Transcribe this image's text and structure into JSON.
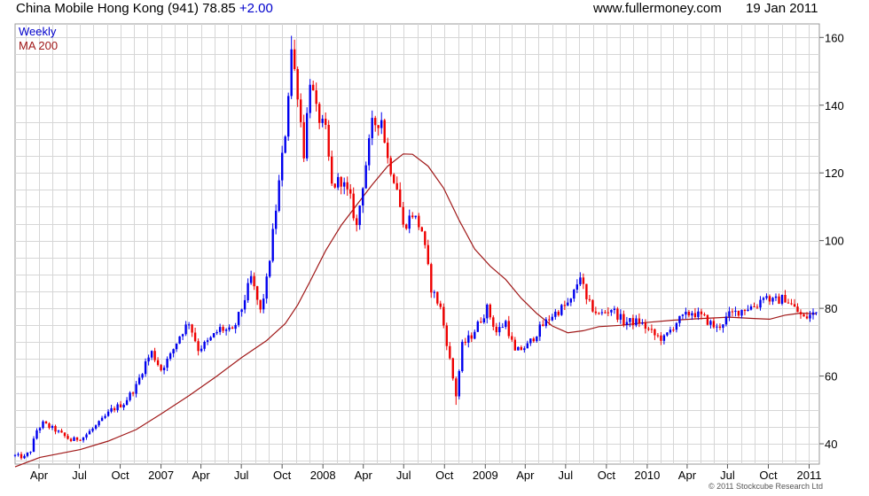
{
  "header": {
    "title": "China Mobile Hong Kong (941) 78.85",
    "change": "+2.00",
    "website": "www.fullermoney.com",
    "date": "19 Jan 2011"
  },
  "legend": {
    "series1": "Weekly",
    "series2": "MA 200"
  },
  "copyright": "© 2011 Stockcube Research Ltd",
  "colors": {
    "up": "#0000ee",
    "down": "#ee0000",
    "ma": "#a01818",
    "grid": "#d6d6d6",
    "change": "#0000cc"
  },
  "chart_data": {
    "type": "candlestick",
    "frequency": "weekly",
    "ylim": [
      34,
      164
    ],
    "yticks": [
      40,
      60,
      80,
      100,
      120,
      140,
      160
    ],
    "x_range": [
      "2006-02-06",
      "2011-01-24"
    ],
    "xticks": [
      {
        "label": "Apr",
        "date": "2006-04-01"
      },
      {
        "label": "Jul",
        "date": "2006-07-01"
      },
      {
        "label": "Oct",
        "date": "2006-10-01"
      },
      {
        "label": "2007",
        "date": "2007-01-01"
      },
      {
        "label": "Apr",
        "date": "2007-04-01"
      },
      {
        "label": "Jul",
        "date": "2007-07-01"
      },
      {
        "label": "Oct",
        "date": "2007-10-01"
      },
      {
        "label": "2008",
        "date": "2008-01-01"
      },
      {
        "label": "Apr",
        "date": "2008-04-01"
      },
      {
        "label": "Jul",
        "date": "2008-07-01"
      },
      {
        "label": "Oct",
        "date": "2008-10-01"
      },
      {
        "label": "2009",
        "date": "2009-01-01"
      },
      {
        "label": "Apr",
        "date": "2009-04-01"
      },
      {
        "label": "Jul",
        "date": "2009-07-01"
      },
      {
        "label": "Oct",
        "date": "2009-10-01"
      },
      {
        "label": "2010",
        "date": "2010-01-01"
      },
      {
        "label": "Apr",
        "date": "2010-04-01"
      },
      {
        "label": "Jul",
        "date": "2010-07-01"
      },
      {
        "label": "Oct",
        "date": "2010-10-01"
      },
      {
        "label": "2011",
        "date": "2011-01-01"
      }
    ],
    "close_anchors": [
      [
        "2006-02-06",
        36.5
      ],
      [
        "2006-02-27",
        36
      ],
      [
        "2006-03-13",
        38
      ],
      [
        "2006-03-27",
        44
      ],
      [
        "2006-04-10",
        46
      ],
      [
        "2006-05-08",
        44
      ],
      [
        "2006-06-12",
        41
      ],
      [
        "2006-07-10",
        42
      ],
      [
        "2006-08-14",
        46
      ],
      [
        "2006-09-11",
        50
      ],
      [
        "2006-10-09",
        52
      ],
      [
        "2006-11-06",
        57
      ],
      [
        "2006-11-27",
        64
      ],
      [
        "2006-12-11",
        67
      ],
      [
        "2007-01-01",
        62
      ],
      [
        "2007-01-22",
        66
      ],
      [
        "2007-02-12",
        72
      ],
      [
        "2007-03-05",
        76
      ],
      [
        "2007-03-26",
        68
      ],
      [
        "2007-04-16",
        70
      ],
      [
        "2007-05-14",
        74
      ],
      [
        "2007-06-11",
        73
      ],
      [
        "2007-07-02",
        80
      ],
      [
        "2007-07-23",
        89
      ],
      [
        "2007-08-13",
        79
      ],
      [
        "2007-08-27",
        88
      ],
      [
        "2007-09-10",
        102
      ],
      [
        "2007-09-24",
        117
      ],
      [
        "2007-10-08",
        132
      ],
      [
        "2007-10-22",
        156
      ],
      [
        "2007-11-05",
        144
      ],
      [
        "2007-11-19",
        126
      ],
      [
        "2007-12-03",
        148
      ],
      [
        "2007-12-17",
        138
      ],
      [
        "2008-01-07",
        132
      ],
      [
        "2008-01-21",
        116
      ],
      [
        "2008-02-11",
        118
      ],
      [
        "2008-03-03",
        112
      ],
      [
        "2008-03-17",
        104
      ],
      [
        "2008-03-31",
        117
      ],
      [
        "2008-04-21",
        134
      ],
      [
        "2008-05-12",
        136
      ],
      [
        "2008-05-26",
        124
      ],
      [
        "2008-06-16",
        116
      ],
      [
        "2008-06-30",
        104
      ],
      [
        "2008-07-21",
        108
      ],
      [
        "2008-08-11",
        103
      ],
      [
        "2008-09-01",
        86
      ],
      [
        "2008-09-22",
        80
      ],
      [
        "2008-10-06",
        70
      ],
      [
        "2008-10-27",
        54
      ],
      [
        "2008-11-10",
        69
      ],
      [
        "2008-12-01",
        72
      ],
      [
        "2009-01-05",
        80
      ],
      [
        "2009-01-26",
        73
      ],
      [
        "2009-02-16",
        76
      ],
      [
        "2009-03-09",
        67
      ],
      [
        "2009-04-06",
        69
      ],
      [
        "2009-05-04",
        74
      ],
      [
        "2009-06-01",
        78
      ],
      [
        "2009-06-22",
        80
      ],
      [
        "2009-07-13",
        82
      ],
      [
        "2009-08-03",
        90
      ],
      [
        "2009-08-17",
        82
      ],
      [
        "2009-09-14",
        78
      ],
      [
        "2009-10-12",
        80
      ],
      [
        "2009-11-09",
        76
      ],
      [
        "2009-12-14",
        76
      ],
      [
        "2010-01-18",
        72
      ],
      [
        "2010-02-08",
        71
      ],
      [
        "2010-03-08",
        76
      ],
      [
        "2010-04-12",
        79
      ],
      [
        "2010-05-10",
        77
      ],
      [
        "2010-06-07",
        74
      ],
      [
        "2010-07-05",
        78
      ],
      [
        "2010-08-09",
        80
      ],
      [
        "2010-09-06",
        81
      ],
      [
        "2010-09-20",
        84
      ],
      [
        "2010-10-11",
        82
      ],
      [
        "2010-11-08",
        83
      ],
      [
        "2010-11-29",
        80
      ],
      [
        "2010-12-20",
        77
      ],
      [
        "2011-01-17",
        78.85
      ]
    ],
    "ma200": [
      [
        "2006-02-06",
        33.2
      ],
      [
        "2006-04-03",
        36
      ],
      [
        "2006-07-03",
        38.3
      ],
      [
        "2006-09-04",
        40.8
      ],
      [
        "2006-11-06",
        44.2
      ],
      [
        "2007-01-01",
        48.8
      ],
      [
        "2007-03-05",
        54.2
      ],
      [
        "2007-05-07",
        60
      ],
      [
        "2007-07-02",
        65.5
      ],
      [
        "2007-08-27",
        70.5
      ],
      [
        "2007-10-08",
        75.5
      ],
      [
        "2007-11-05",
        81
      ],
      [
        "2007-12-03",
        88
      ],
      [
        "2008-01-07",
        97
      ],
      [
        "2008-02-11",
        104.5
      ],
      [
        "2008-03-17",
        110.5
      ],
      [
        "2008-04-21",
        116.5
      ],
      [
        "2008-05-26",
        122
      ],
      [
        "2008-06-30",
        125.6
      ],
      [
        "2008-07-21",
        125.5
      ],
      [
        "2008-08-25",
        122
      ],
      [
        "2008-09-29",
        115.5
      ],
      [
        "2008-11-03",
        106
      ],
      [
        "2008-12-08",
        97.5
      ],
      [
        "2009-01-12",
        92.5
      ],
      [
        "2009-02-16",
        88.5
      ],
      [
        "2009-03-23",
        83
      ],
      [
        "2009-04-27",
        78.5
      ],
      [
        "2009-06-01",
        74.8
      ],
      [
        "2009-07-06",
        72.8
      ],
      [
        "2009-08-10",
        73.4
      ],
      [
        "2009-09-14",
        74.6
      ],
      [
        "2009-11-02",
        75
      ],
      [
        "2009-12-28",
        75.8
      ],
      [
        "2010-03-01",
        76.5
      ],
      [
        "2010-05-03",
        77
      ],
      [
        "2010-07-05",
        77.4
      ],
      [
        "2010-08-30",
        77
      ],
      [
        "2010-10-04",
        76.8
      ],
      [
        "2010-11-08",
        78
      ],
      [
        "2010-12-13",
        78.6
      ],
      [
        "2011-01-17",
        78.4
      ]
    ],
    "extremes": [
      [
        "2007-10-22",
        156.5,
        160.5
      ],
      [
        "2008-10-27",
        54,
        51.5
      ]
    ]
  }
}
